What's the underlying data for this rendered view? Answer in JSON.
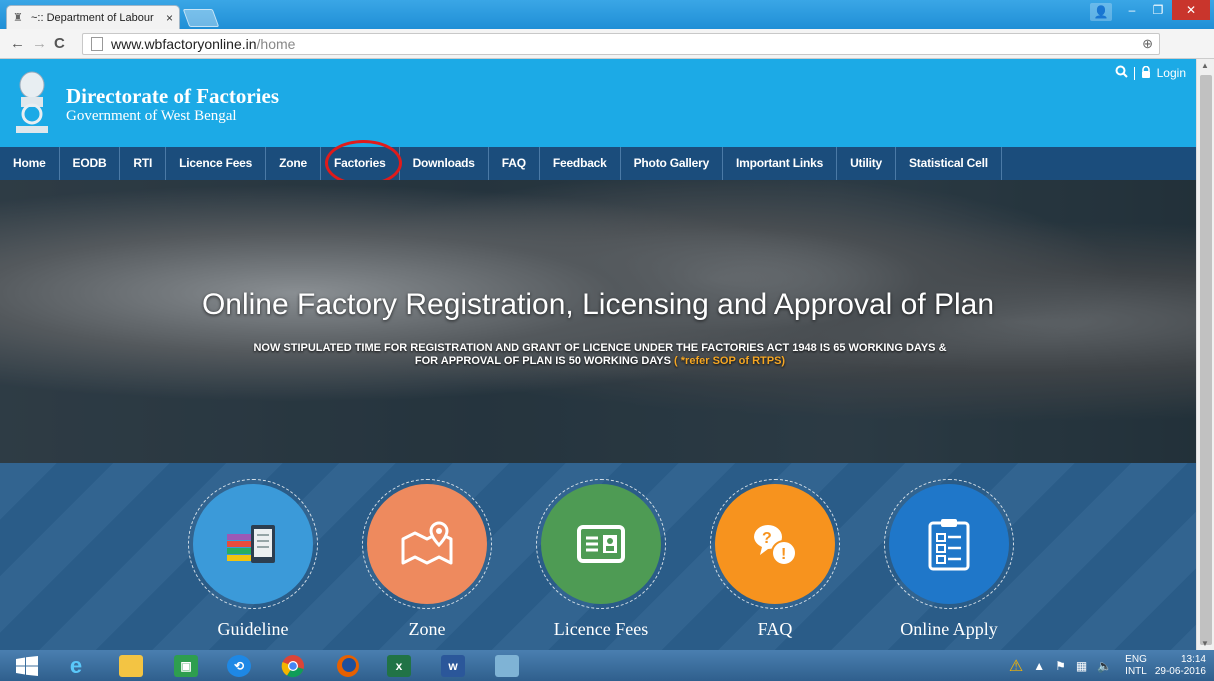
{
  "browser": {
    "tab_title": "~:: Department of Labour",
    "tab_close": "×",
    "url_domain": "www.wbfactoryonline.in",
    "url_path": "/home"
  },
  "site": {
    "title": "Directorate of Factories",
    "subtitle": "Government of West Bengal",
    "login_label": "Login"
  },
  "nav": {
    "items": [
      "Home",
      "EODB",
      "RTI",
      "Licence Fees",
      "Zone",
      "Factories",
      "Downloads",
      "FAQ",
      "Feedback",
      "Photo Gallery",
      "Important Links",
      "Utility",
      "Statistical Cell"
    ],
    "highlighted": "Factories"
  },
  "hero": {
    "title": "Online Factory Registration, Licensing and Approval of Plan",
    "notice": "NOW STIPULATED TIME FOR REGISTRATION AND GRANT OF LICENCE UNDER THE FACTORIES ACT 1948 IS 65 WORKING DAYS & FOR APPROVAL OF PLAN IS 50 WORKING DAYS",
    "notice_ref": "( *refer SOP of RTPS)"
  },
  "quicklinks": [
    {
      "label": "Guideline",
      "color": "#3b9ad9",
      "icon": "books-tablet-icon"
    },
    {
      "label": "Zone",
      "color": "#ee8a5e",
      "icon": "map-pin-icon"
    },
    {
      "label": "Licence Fees",
      "color": "#4e9b54",
      "icon": "id-card-icon"
    },
    {
      "label": "FAQ",
      "color": "#f7931e",
      "icon": "question-chat-icon"
    },
    {
      "label": "Online Apply",
      "color": "#1f77c9",
      "icon": "clipboard-checklist-icon"
    }
  ],
  "taskbar": {
    "lang_top": "ENG",
    "lang_bottom": "INTL",
    "time": "13:14",
    "date": "29-06-2016"
  }
}
